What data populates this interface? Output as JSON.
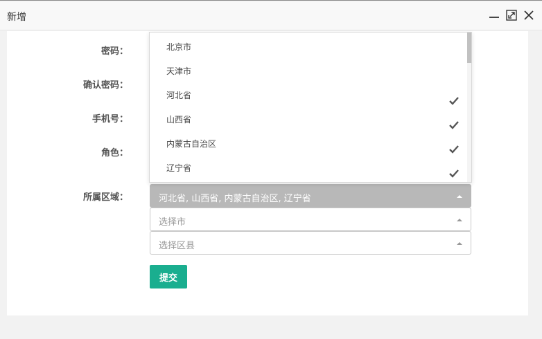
{
  "window": {
    "title": "新增"
  },
  "form": {
    "labels": {
      "password": "密码：",
      "confirm_password": "确认密码：",
      "phone": "手机号：",
      "role": "角色：",
      "region": "所属区域："
    },
    "region_select": {
      "value": "河北省, 山西省, 内蒙古自治区, 辽宁省"
    },
    "city_select": {
      "placeholder": "选择市"
    },
    "county_select": {
      "placeholder": "选择区县"
    },
    "submit_label": "提交"
  },
  "dropdown": {
    "items": [
      {
        "label": "北京市",
        "checked": false
      },
      {
        "label": "天津市",
        "checked": false
      },
      {
        "label": "河北省",
        "checked": true
      },
      {
        "label": "山西省",
        "checked": true
      },
      {
        "label": "内蒙古自治区",
        "checked": true
      },
      {
        "label": "辽宁省",
        "checked": true
      }
    ]
  },
  "colors": {
    "primary": "#1aae8f",
    "selected_bg": "#b8b8b8",
    "check": "#555555"
  }
}
